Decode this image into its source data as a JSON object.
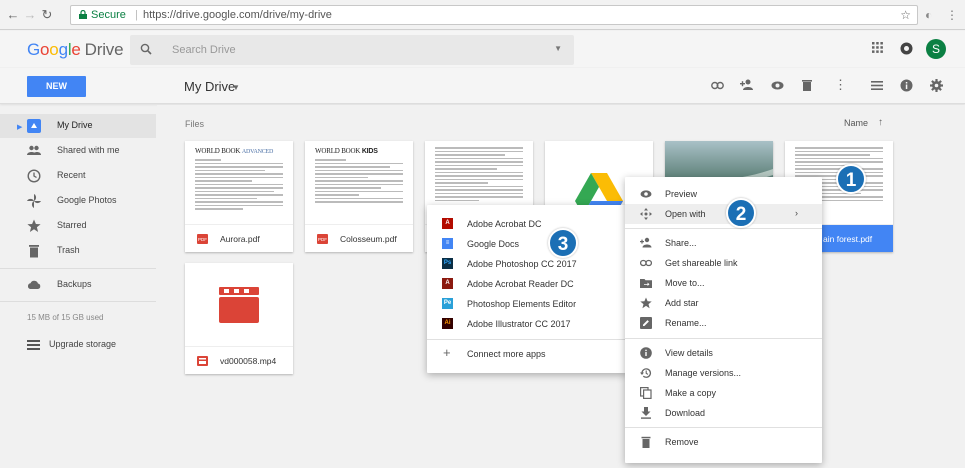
{
  "browser": {
    "secure_label": "Secure",
    "url": "https://drive.google.com/drive/my-drive"
  },
  "header": {
    "logo_google": [
      "G",
      "o",
      "o",
      "g",
      "l",
      "e"
    ],
    "logo_drive": "Drive",
    "search_placeholder": "Search Drive",
    "avatar_letter": "S"
  },
  "toolbar": {
    "new_label": "NEW",
    "title": "My Drive"
  },
  "sidebar": {
    "items": [
      {
        "label": "My Drive"
      },
      {
        "label": "Shared with me"
      },
      {
        "label": "Recent"
      },
      {
        "label": "Google Photos"
      },
      {
        "label": "Starred"
      },
      {
        "label": "Trash"
      },
      {
        "label": "Backups"
      }
    ],
    "storage_text": "15 MB of 15 GB used",
    "upgrade_label": "Upgrade storage"
  },
  "main": {
    "files_label": "Files",
    "sort_label": "Name",
    "files": [
      {
        "name": "Aurora.pdf",
        "thumb_title_1": "WORLD BOOK",
        "thumb_title_2": "ADVANCED"
      },
      {
        "name": "Colosseum.pdf",
        "thumb_title_1": "WORLD BOOK",
        "thumb_title_2": "KIDS"
      },
      {
        "name": "ain forest.pdf"
      },
      {
        "name": "vd000058.mp4"
      }
    ]
  },
  "context_menu": {
    "items": [
      {
        "label": "Preview"
      },
      {
        "label": "Open with"
      },
      {
        "label": "Share..."
      },
      {
        "label": "Get shareable link"
      },
      {
        "label": "Move to..."
      },
      {
        "label": "Add star"
      },
      {
        "label": "Rename..."
      },
      {
        "label": "View details"
      },
      {
        "label": "Manage versions..."
      },
      {
        "label": "Make a copy"
      },
      {
        "label": "Download"
      },
      {
        "label": "Remove"
      }
    ]
  },
  "open_with_menu": {
    "items": [
      {
        "label": "Adobe Acrobat DC"
      },
      {
        "label": "Google Docs"
      },
      {
        "label": "Adobe Photoshop CC 2017"
      },
      {
        "label": "Adobe Acrobat Reader DC"
      },
      {
        "label": "Photoshop Elements Editor"
      },
      {
        "label": "Adobe Illustrator CC 2017"
      }
    ],
    "connect_label": "Connect more apps"
  },
  "badges": [
    "1",
    "2",
    "3"
  ],
  "colors": {
    "accent_blue": "#4285f4",
    "badge_blue": "#1b6fb5",
    "pdf_red": "#db4437",
    "avatar_green": "#0b8043"
  }
}
